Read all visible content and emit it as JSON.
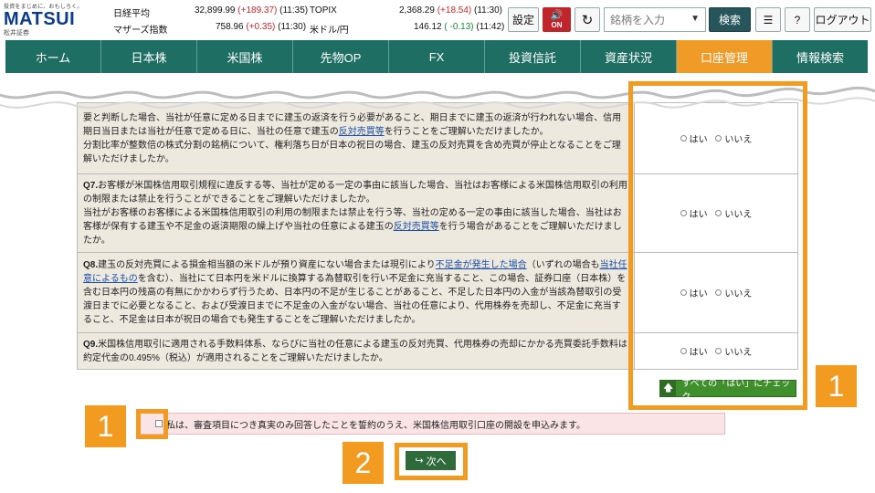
{
  "header": {
    "logo_tagline": "投資をまじめに、おもしろく。",
    "logo_brand": "MATSUI",
    "logo_sub": "松井証券",
    "indices": [
      {
        "name": "日経平均",
        "value": "32,899.99",
        "change": "(+189.37)",
        "time": "(11:35)",
        "dir": "up"
      },
      {
        "name": "マザーズ指数",
        "value": "758.96",
        "change": "(+0.35)",
        "time": "(11:30)",
        "dir": "up"
      },
      {
        "name": "TOPIX",
        "value": "2,368.29",
        "change": "(+18.54)",
        "time": "(11:30)",
        "dir": "up"
      },
      {
        "name": "米ドル/円",
        "value": "146.12",
        "change": "( -0.13)",
        "time": "(11:42)",
        "dir": "down"
      }
    ],
    "settings_label": "設定",
    "sound_label": "ON",
    "search_placeholder": "銘柄を入力",
    "search_button": "検索",
    "help_label": "?",
    "logout_label": "ログアウト"
  },
  "nav": {
    "tabs": [
      "ホーム",
      "日本株",
      "米国株",
      "先物OP",
      "FX",
      "投資信託",
      "資産状況",
      "口座管理",
      "情報検索"
    ],
    "active_index": 7
  },
  "questions": [
    {
      "lines_top": "要と判断した場合、当社が任意に定める日までに建玉の返済を行う必要があること、期日までに建玉の返済が行われない場合、信用期日当日または当社が任意で定める日に、当社の任意で建玉の",
      "link": "反対売買等",
      "lines_after": "を行うことをご理解いただけましたか。",
      "extra": "分割比率が整数倍の株式分割の銘柄について、権利落ち日が日本の祝日の場合、建玉の反対売買を含め売買が停止となることをご理解いただけましたか。"
    },
    {
      "num": "Q7.",
      "text1": "お客様が米国株信用取引規程に違反する等、当社が定める一定の事由に該当した場合、当社はお客様による米国株信用取引の利用の制限または禁止を行うことができることをご理解いただけましたか。",
      "text2": "当社がお客様のお客様による米国株信用取引の利用の制限または禁止を行う等、当社の定める一定の事由に該当した場合、当社はお客様が保有する建玉や不足金の返済期限の繰上げや当社の任意による建玉の",
      "link": "反対売買等",
      "text3": "を行う場合があることをご理解いただけましたか。"
    },
    {
      "num": "Q8.",
      "text1": "建玉の反対売買による損金相当額の米ドルが預り資産にない場合または現引により",
      "link1": "不足金が発生した場合",
      "text2": "（いずれの場合も",
      "link2": "当社任意によるもの",
      "text3": "を含む）、当社にて日本円を米ドルに換算する為替取引を行い不足金に充当すること、この場合、証券口座（日本株）を含む日本円の残高の有無にかかわらず行うため、日本円の不足が生じることがあること、不足した日本円の入金が当該為替取引の受渡日までに必要となること、および受渡日までに不足金の入金がない場合、当社の任意により、代用株券を売却し、不足金に充当すること、不足金は日本が祝日の場合でも発生することをご理解いただけましたか。"
    },
    {
      "num": "Q9.",
      "text1": "米国株信用取引に適用される手数料体系、ならびに当社の任意による建玉の反対売買、代用株券の売却にかかる売買委託手数料は約定代金の0.495%（税込）が適用されることをご理解いただけましたか。"
    }
  ],
  "answer": {
    "yes": "はい",
    "no": "いいえ"
  },
  "check_all_label": "すべての「はい」にチェック",
  "agree_text": "私は、審査項目につき真実のみ回答したことを誓約のうえ、米国株信用取引口座の開設を申込みます。",
  "next_label": "次へ",
  "callouts": [
    "1",
    "1",
    "2"
  ],
  "colors": {
    "highlight": "#f39a20",
    "nav": "#1f6e63",
    "nav_active": "#f09a28",
    "brand": "#0b3b8c"
  }
}
